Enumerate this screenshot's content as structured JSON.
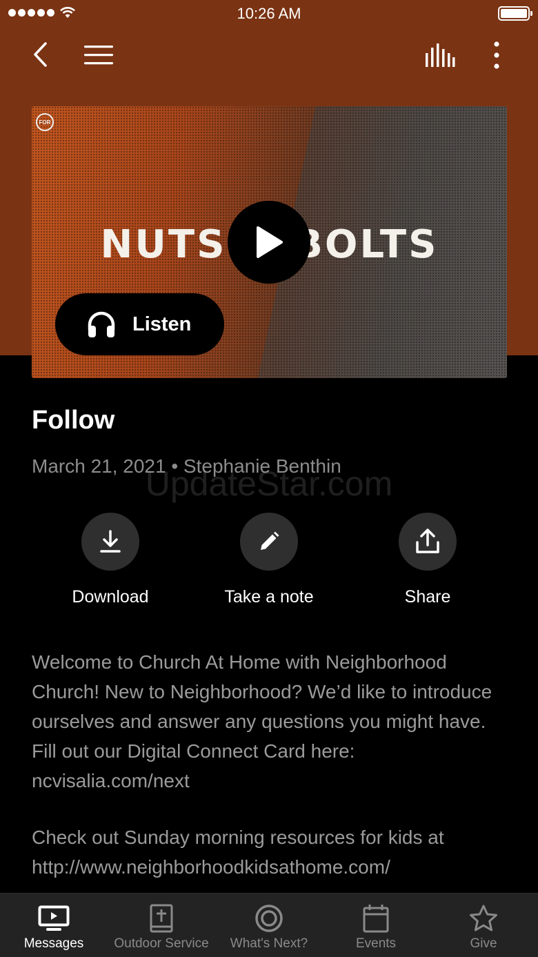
{
  "status_bar": {
    "time": "10:26 AM"
  },
  "nav": {
    "back_icon": "chevron-left-icon",
    "menu_icon": "hamburger-icon",
    "audio_icon": "audio-bars-icon",
    "more_icon": "more-vertical-icon"
  },
  "artwork": {
    "badge": "FOR",
    "title": "NUTS & BOLTS",
    "play_icon": "play-icon",
    "listen_label": "Listen"
  },
  "message": {
    "title": "Follow",
    "meta": "March 21, 2021 • Stephanie Benthin",
    "watermark": "UpdateStar.com"
  },
  "actions": [
    {
      "label": "Download",
      "icon": "download-icon"
    },
    {
      "label": "Take a note",
      "icon": "pencil-icon"
    },
    {
      "label": "Share",
      "icon": "share-icon"
    }
  ],
  "description": {
    "p1": "Welcome to Church At Home with Neighborhood Church! New to Neighborhood? We’d like to introduce ourselves and answer any questions you might have. Fill out our Digital Connect Card here: ncvisalia.com/next",
    "p2": "Check out Sunday morning resources for kids at http://www.neighborhoodkidsathome.com/"
  },
  "tabs": [
    {
      "label": "Messages",
      "icon": "tv-icon",
      "active": true
    },
    {
      "label": "Outdoor Service",
      "icon": "bible-icon",
      "active": false
    },
    {
      "label": "What's Next?",
      "icon": "target-icon",
      "active": false
    },
    {
      "label": "Events",
      "icon": "calendar-icon",
      "active": false
    },
    {
      "label": "Give",
      "icon": "star-icon",
      "active": false
    }
  ],
  "colors": {
    "header_bg": "#7a3313",
    "background": "#000000",
    "tab_bar_bg": "#232323",
    "muted_text": "#9b9b9b"
  }
}
